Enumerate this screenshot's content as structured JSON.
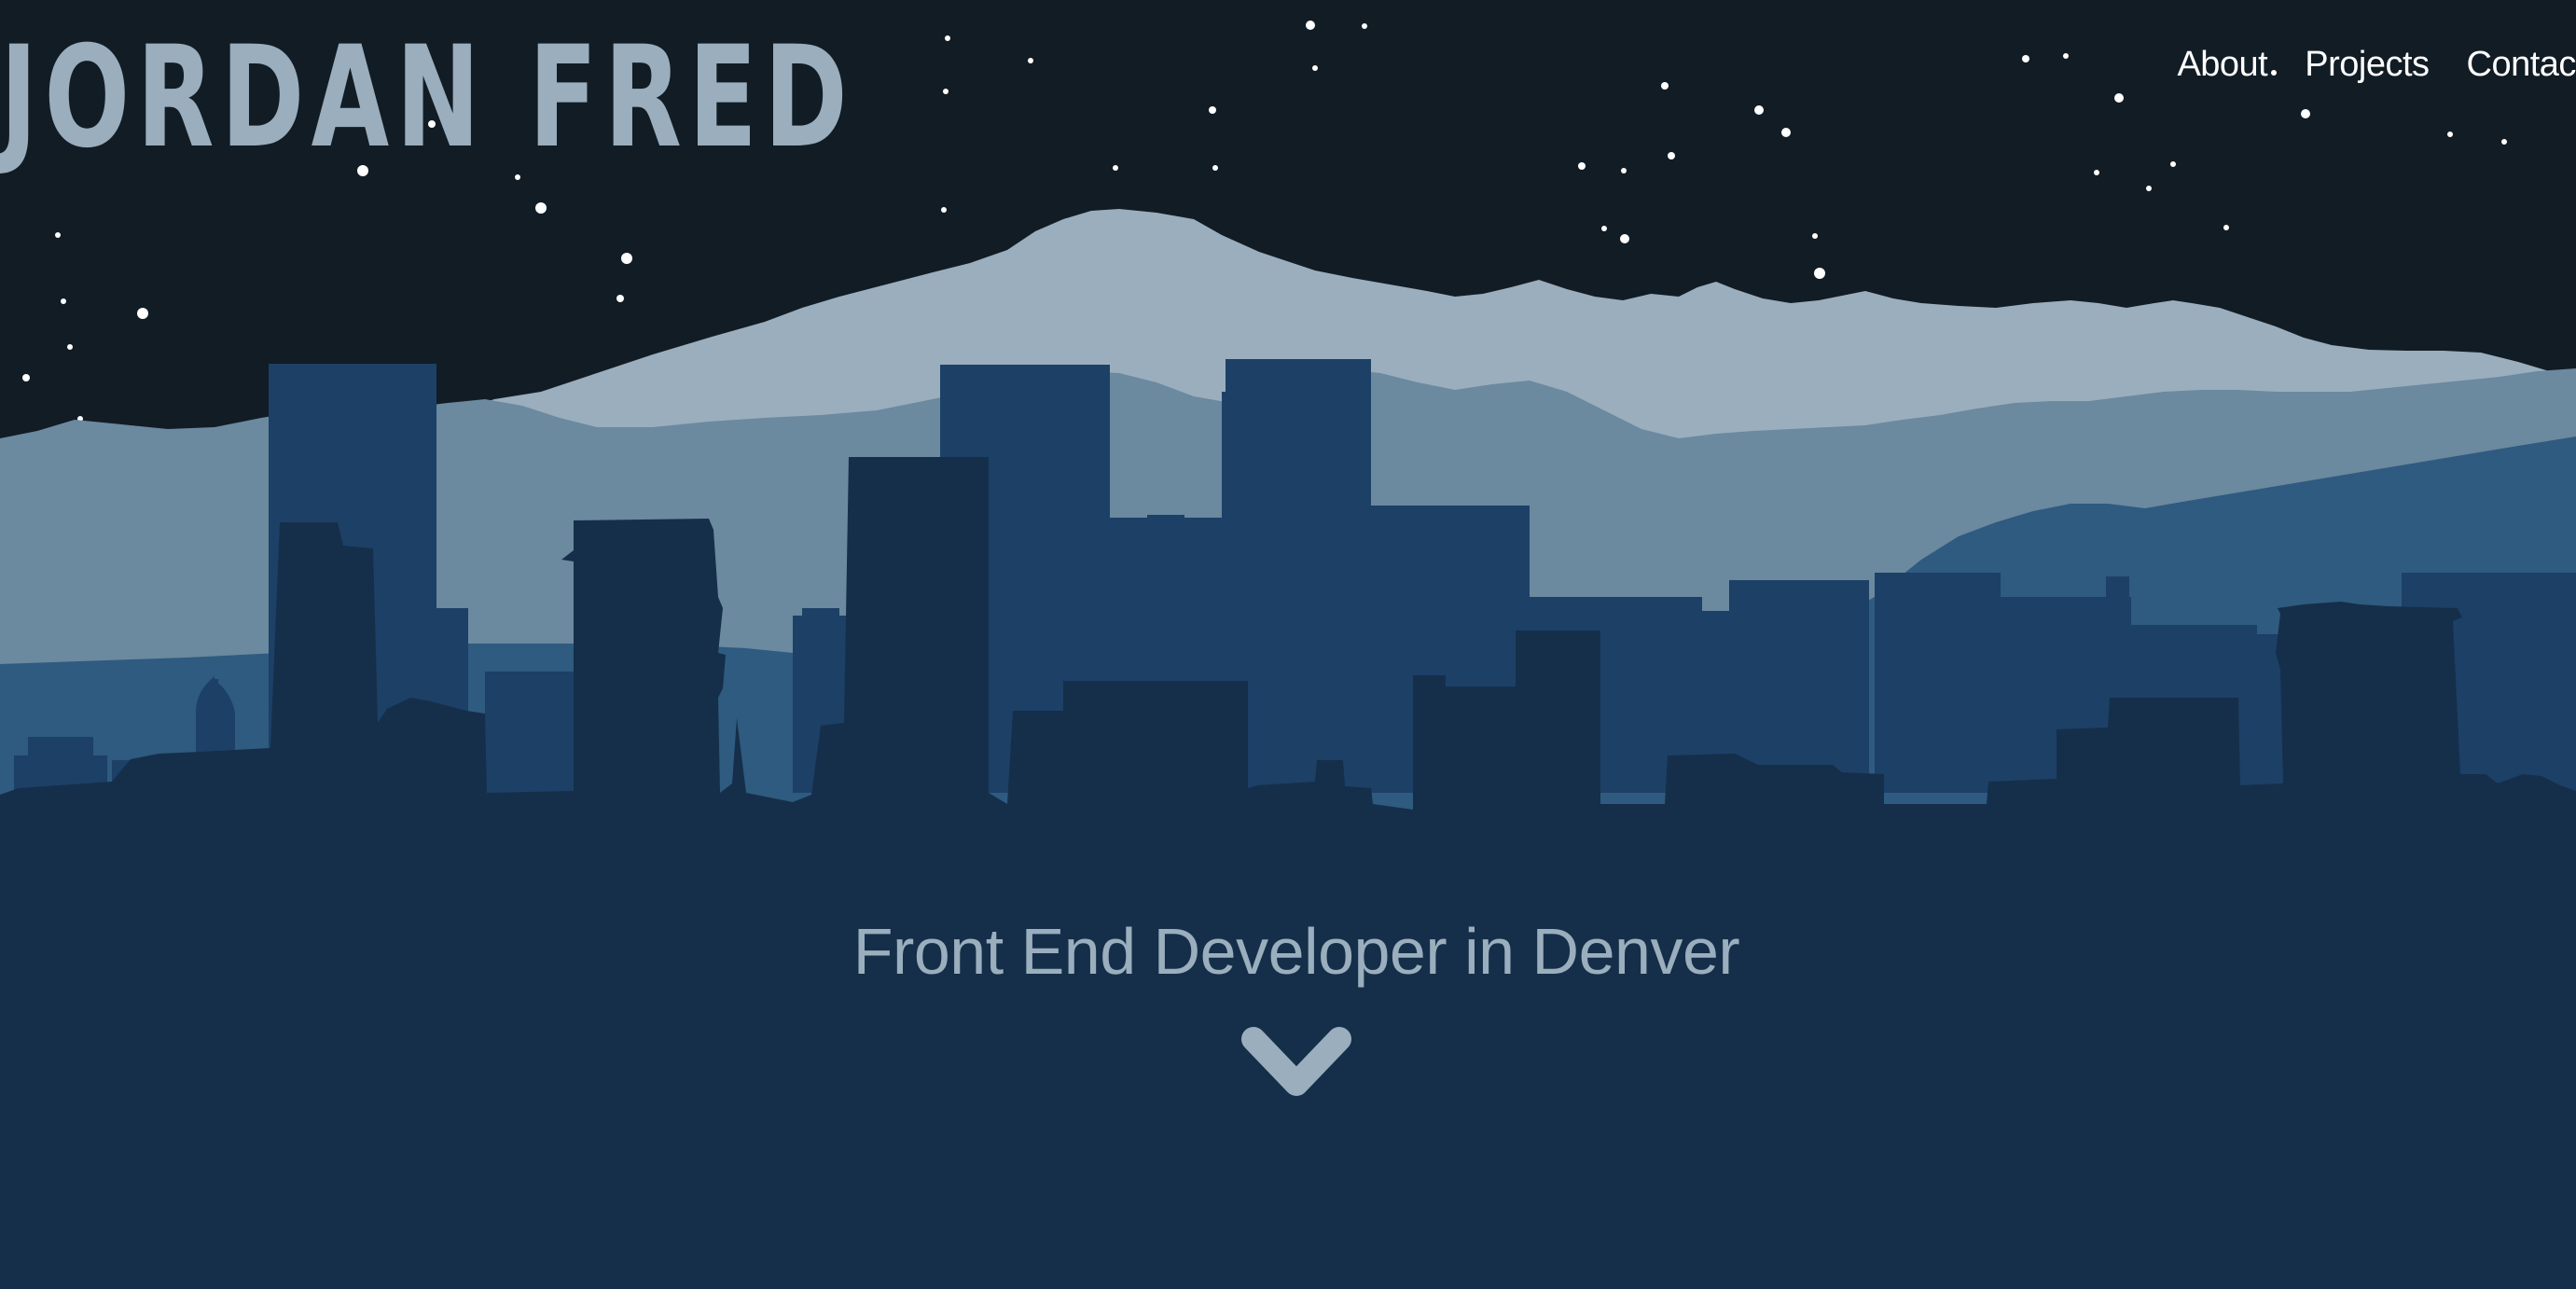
{
  "brand": {
    "name": "Jordan Fred"
  },
  "nav": {
    "items": [
      "About",
      "Projects",
      "Contact"
    ]
  },
  "hero": {
    "tagline": "Front End Developer in Denver",
    "scroll_icon": "chevron-down-icon"
  },
  "colors": {
    "sky": "#121c25",
    "snow_peaks": "#9aaebd",
    "mid_mountains": "#6b899f",
    "far_hills": "#2e5b7f",
    "back_buildings": "#1d4067",
    "front_buildings": "#152f4a",
    "text_muted": "#9aaebd",
    "nav_text": "#ffffff"
  }
}
